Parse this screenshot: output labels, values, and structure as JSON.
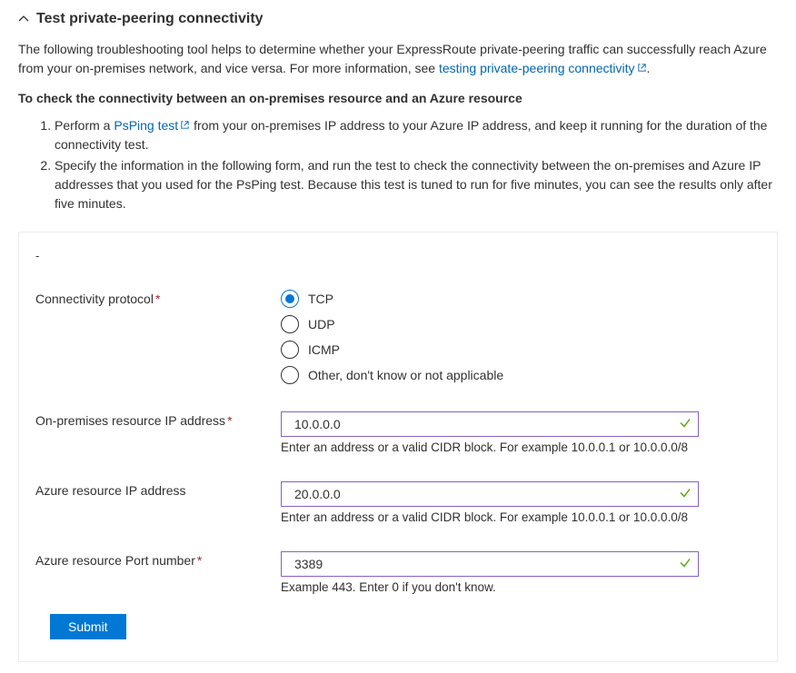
{
  "header": {
    "title": "Test private-peering connectivity"
  },
  "intro": {
    "text_before_link": "The following troubleshooting tool helps to determine whether your ExpressRoute private-peering traffic can successfully reach Azure from your on-premises network, and vice versa. For more information, see ",
    "link_text": "testing private-peering connectivity",
    "text_after_link": "."
  },
  "subheading": "To check the connectivity between an on-premises resource and an Azure resource",
  "steps": {
    "s1_before": "Perform a ",
    "s1_link": "PsPing test",
    "s1_after": " from your on-premises IP address to your Azure IP address, and keep it running for the duration of the connectivity test.",
    "s2": "Specify the information in the following form, and run the test to check the connectivity between the on-premises and Azure IP addresses that you used for the PsPing test. Because this test is tuned to run for five minutes, you can see the results only after five minutes."
  },
  "form": {
    "collapse_symbol": "-",
    "protocol": {
      "label": "Connectivity protocol",
      "required": "*",
      "options": {
        "tcp": "TCP",
        "udp": "UDP",
        "icmp": "ICMP",
        "other": "Other, don't know or not applicable"
      },
      "selected": "tcp"
    },
    "onprem_ip": {
      "label": "On-premises resource IP address",
      "required": "*",
      "value": "10.0.0.0",
      "hint": "Enter an address or a valid CIDR block. For example 10.0.0.1 or 10.0.0.0/8"
    },
    "azure_ip": {
      "label": "Azure resource IP address",
      "required": "",
      "value": "20.0.0.0",
      "hint": "Enter an address or a valid CIDR block. For example 10.0.0.1 or 10.0.0.0/8"
    },
    "azure_port": {
      "label": "Azure resource Port number",
      "required": "*",
      "value": "3389",
      "hint": "Example 443. Enter 0 if you don't know."
    },
    "submit_label": "Submit"
  }
}
